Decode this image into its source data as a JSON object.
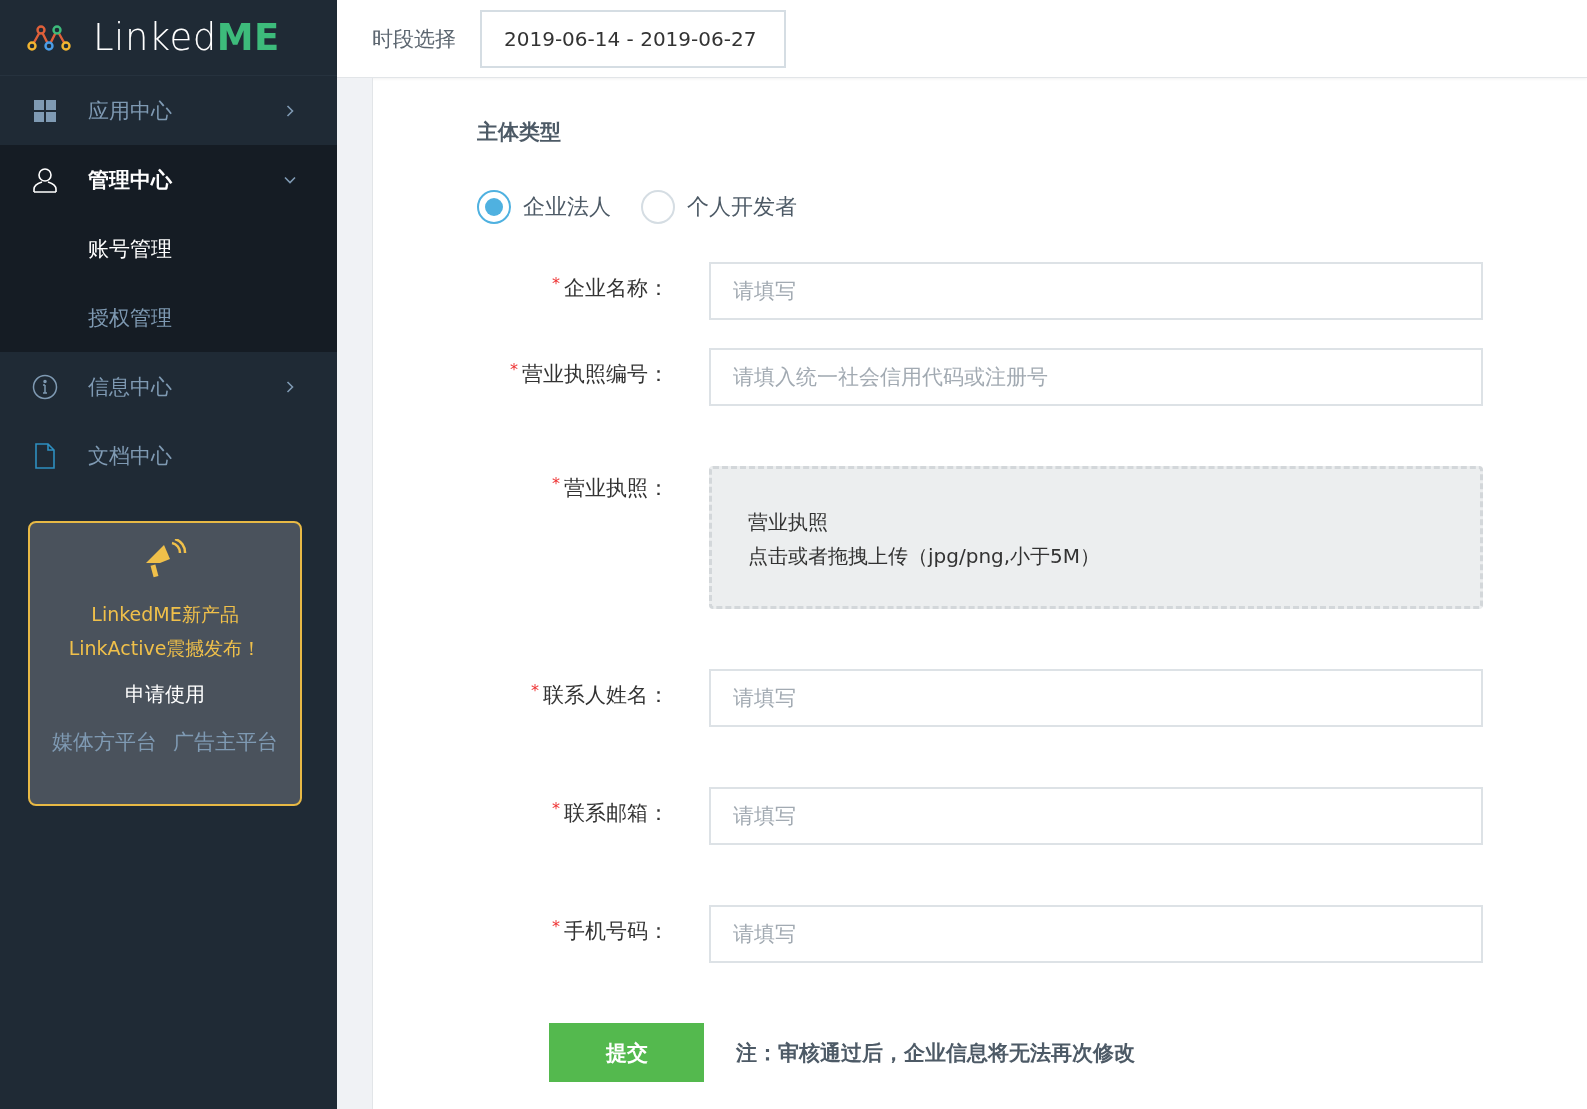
{
  "logo": {
    "text_main": "Linked",
    "text_accent": "ME"
  },
  "sidebar": {
    "items": [
      {
        "label": "应用中心",
        "expanded": false,
        "has_arrow": true
      },
      {
        "label": "管理中心",
        "expanded": true,
        "has_arrow": true,
        "children": [
          {
            "label": "账号管理",
            "selected": true
          },
          {
            "label": "授权管理",
            "selected": false
          }
        ]
      },
      {
        "label": "信息中心",
        "expanded": false,
        "has_arrow": true
      },
      {
        "label": "文档中心",
        "expanded": false,
        "has_arrow": false
      }
    ]
  },
  "promo": {
    "line1": "LinkedME新产品",
    "line2": "LinkActive震撼发布！",
    "cta": "申请使用",
    "links": [
      "媒体方平台",
      "广告主平台"
    ]
  },
  "header": {
    "label": "时段选择",
    "date_range": "2019-06-14 - 2019-06-27"
  },
  "form": {
    "section_title": "主体类型",
    "entity_types": [
      {
        "label": "企业法人",
        "selected": true
      },
      {
        "label": "个人开发者",
        "selected": false
      }
    ],
    "fields": [
      {
        "kind": "input",
        "required_mark": "*",
        "label": "企业名称：",
        "placeholder": "请填写"
      },
      {
        "kind": "input",
        "required_mark": "*",
        "label": "营业执照编号：",
        "placeholder": "请填入统一社会信用代码或注册号"
      },
      {
        "kind": "upload",
        "required_mark": "*",
        "label": "营业执照：",
        "title": "营业执照",
        "hint": "点击或者拖拽上传（jpg/png,小于5M）"
      },
      {
        "kind": "input",
        "required_mark": "*",
        "label": "联系人姓名：",
        "placeholder": "请填写"
      },
      {
        "kind": "input",
        "required_mark": "*",
        "label": "联系邮箱：",
        "placeholder": "请填写"
      },
      {
        "kind": "input",
        "required_mark": "*",
        "label": "手机号码：",
        "placeholder": "请填写"
      }
    ],
    "submit": "提交",
    "note": "注：审核通过后，企业信息将无法再次修改"
  }
}
